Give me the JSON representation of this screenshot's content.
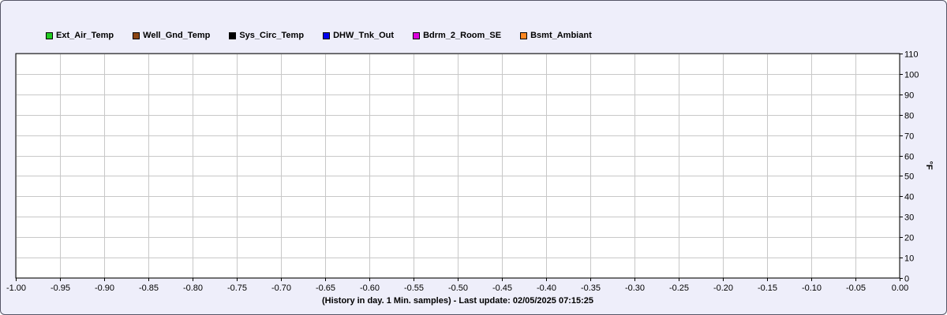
{
  "chart_data": {
    "type": "line",
    "title": "",
    "xlabel": "(History in day. 1 Min. samples) - Last update: 02/05/2025 07:15:25",
    "ylabel": "°F",
    "xlim": [
      -1.0,
      0.0
    ],
    "ylim": [
      0,
      110
    ],
    "x_ticks": [
      "-1.00",
      "-0.95",
      "-0.90",
      "-0.85",
      "-0.80",
      "-0.75",
      "-0.70",
      "-0.65",
      "-0.60",
      "-0.55",
      "-0.50",
      "-0.45",
      "-0.40",
      "-0.35",
      "-0.30",
      "-0.25",
      "-0.20",
      "-0.15",
      "-0.10",
      "-0.05",
      "0.00"
    ],
    "y_ticks": [
      "0",
      "10",
      "20",
      "30",
      "40",
      "50",
      "60",
      "70",
      "80",
      "90",
      "100",
      "110"
    ],
    "grid": true,
    "legend_position": "top-left",
    "series": [
      {
        "name": "Ext_Air_Temp",
        "color": "#22cc22",
        "values": []
      },
      {
        "name": "Well_Gnd_Temp",
        "color": "#8b4513",
        "values": []
      },
      {
        "name": "Sys_Circ_Temp",
        "color": "#000000",
        "values": []
      },
      {
        "name": "DHW_Tnk_Out",
        "color": "#0000ee",
        "values": []
      },
      {
        "name": "Bdrm_2_Room_SE",
        "color": "#dd00dd",
        "values": []
      },
      {
        "name": "Bsmt_Ambiant",
        "color": "#ff8822",
        "values": []
      }
    ]
  }
}
